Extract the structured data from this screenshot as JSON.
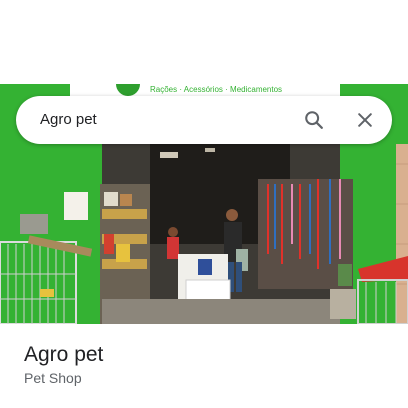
{
  "search": {
    "query": "Agro pet"
  },
  "photo": {
    "sign_text": "Rações · Acessórios · Medicamentos",
    "wall_color": "#34b233",
    "accent_red": "#e0312a"
  },
  "place": {
    "name": "Agro pet",
    "category": "Pet Shop"
  },
  "icons": {
    "search": "search-icon",
    "close": "close-icon"
  }
}
